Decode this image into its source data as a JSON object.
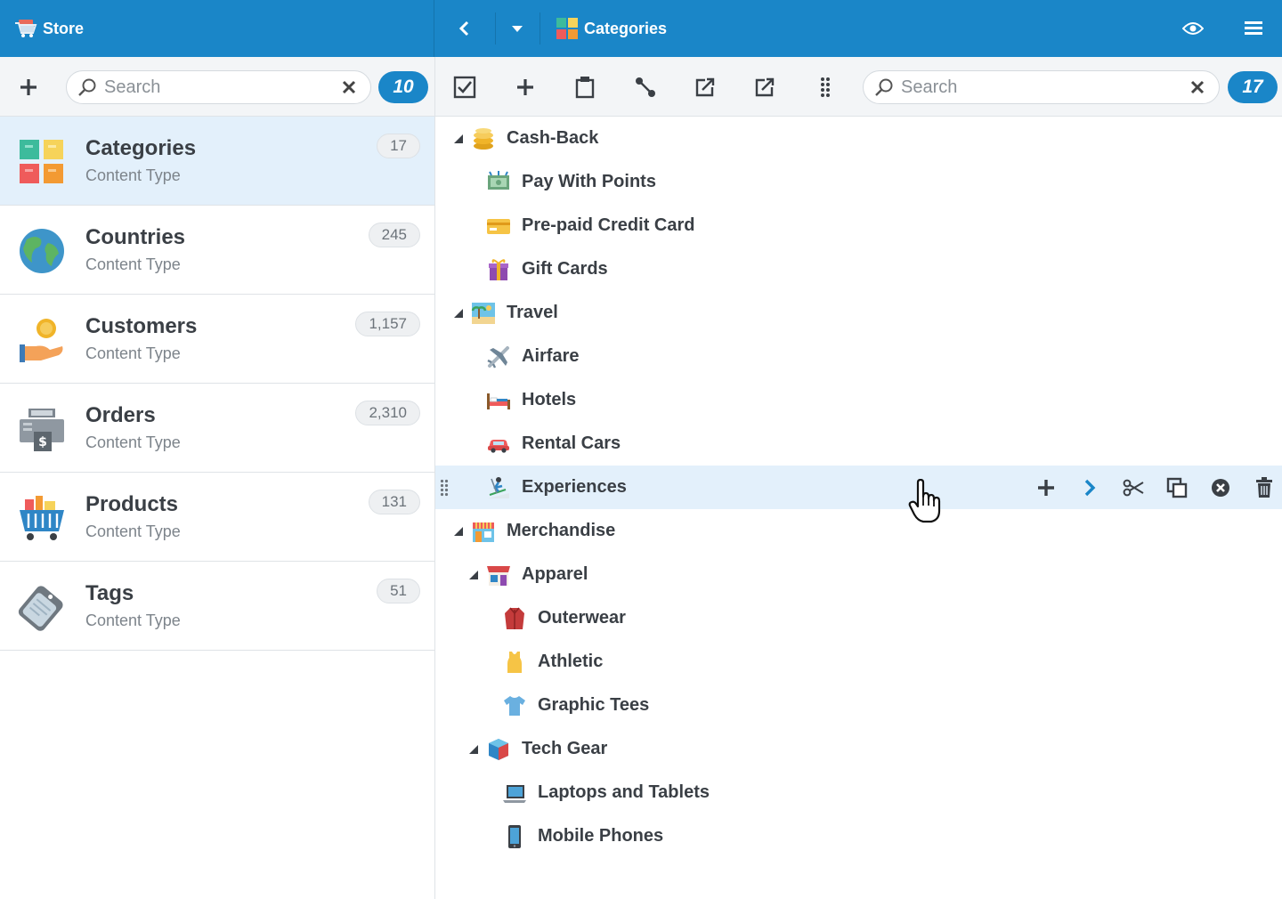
{
  "topbar": {
    "app_title": "Store",
    "view_title": "Categories",
    "icons": [
      "cart-icon",
      "back-icon",
      "dropdown-icon",
      "categories-grid-icon",
      "eye-icon",
      "menu-icon"
    ],
    "colors": {
      "bar": "#1a86c8",
      "accent": "#1a86c8",
      "selection": "#e3f0fb"
    }
  },
  "left": {
    "search_placeholder": "Search",
    "count": "10",
    "types": [
      {
        "name": "Categories",
        "subtitle": "Content Type",
        "count": "17",
        "icon": "categories-icon"
      },
      {
        "name": "Countries",
        "subtitle": "Content Type",
        "count": "245",
        "icon": "globe-icon"
      },
      {
        "name": "Customers",
        "subtitle": "Content Type",
        "count": "1,157",
        "icon": "hand-coin-icon"
      },
      {
        "name": "Orders",
        "subtitle": "Content Type",
        "count": "2,310",
        "icon": "register-icon"
      },
      {
        "name": "Products",
        "subtitle": "Content Type",
        "count": "131",
        "icon": "basket-icon"
      },
      {
        "name": "Tags",
        "subtitle": "Content Type",
        "count": "51",
        "icon": "tag-icon"
      }
    ]
  },
  "right": {
    "search_placeholder": "Search",
    "count": "17",
    "tools": [
      "select-all-icon",
      "add-icon",
      "clipboard-icon",
      "connect-icon",
      "export-icon",
      "import-icon",
      "drag-handle-icon"
    ],
    "tree": [
      {
        "label": "Cash-Back",
        "level": 0,
        "expanded": true,
        "icon": "coins-icon"
      },
      {
        "label": "Pay With Points",
        "level": 1,
        "icon": "money-icon"
      },
      {
        "label": "Pre-paid Credit Card",
        "level": 1,
        "icon": "credit-card-icon"
      },
      {
        "label": "Gift Cards",
        "level": 1,
        "icon": "gift-icon"
      },
      {
        "label": "Travel",
        "level": 0,
        "expanded": true,
        "icon": "beach-icon"
      },
      {
        "label": "Airfare",
        "level": 1,
        "icon": "airplane-icon"
      },
      {
        "label": "Hotels",
        "level": 1,
        "icon": "bed-icon"
      },
      {
        "label": "Rental Cars",
        "level": 1,
        "icon": "car-icon"
      },
      {
        "label": "Experiences",
        "level": 1,
        "icon": "skier-icon",
        "highlighted": true
      },
      {
        "label": "Merchandise",
        "level": 0,
        "expanded": true,
        "icon": "shop-icon"
      },
      {
        "label": "Apparel",
        "level": 1,
        "expanded": true,
        "icon": "store-icon"
      },
      {
        "label": "Outerwear",
        "level": 2,
        "icon": "coat-icon"
      },
      {
        "label": "Athletic",
        "level": 2,
        "icon": "tank-top-icon"
      },
      {
        "label": "Graphic Tees",
        "level": 2,
        "icon": "tshirt-icon"
      },
      {
        "label": "Tech Gear",
        "level": 1,
        "expanded": true,
        "icon": "box-icon"
      },
      {
        "label": "Laptops and Tablets",
        "level": 2,
        "icon": "laptop-icon"
      },
      {
        "label": "Mobile Phones",
        "level": 2,
        "icon": "phone-icon"
      }
    ],
    "row_actions": [
      "add-icon",
      "chevron-right-icon",
      "scissors-icon",
      "duplicate-icon",
      "remove-icon",
      "trash-icon"
    ]
  }
}
